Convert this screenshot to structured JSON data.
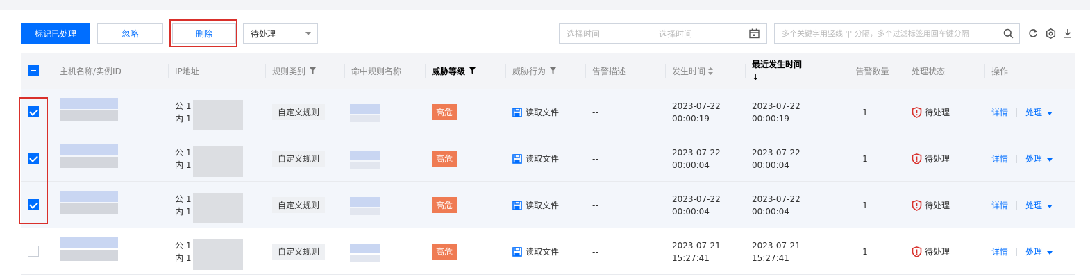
{
  "toolbar": {
    "mark_processed_label": "标记已处理",
    "ignore_label": "忽略",
    "delete_label": "删除",
    "status_filter_value": "待处理",
    "date_start_placeholder": "选择时间",
    "date_end_placeholder": "选择时间",
    "search_placeholder": "多个关键字用竖线 '|' 分隔，多个过滤标签用回车键分隔"
  },
  "colors": {
    "primary": "#006eff",
    "danger": "#d9302b",
    "high_risk": "#ef7b53"
  },
  "icons": [
    "calendar-icon",
    "search-icon",
    "refresh-icon",
    "settings-icon",
    "download-icon",
    "filter-icon",
    "sort-icon",
    "file-save-icon",
    "shield-alert-icon",
    "caret-down-icon"
  ],
  "columns": {
    "host": "主机名称/实例ID",
    "ip": "IP地址",
    "rule_type": "规则类别",
    "rule_name": "命中规则名称",
    "threat_level": "威胁等级",
    "threat_action": "威胁行为",
    "alert_desc": "告警描述",
    "occur_time": "发生时间",
    "latest_time_line1": "最近发生时间",
    "latest_time_line2": "↓",
    "alert_count": "告警数量",
    "status": "处理状态",
    "ops": "操作"
  },
  "rows": [
    {
      "checked": true,
      "ip_public": "公 1",
      "ip_private": "内 1",
      "rule_type": "自定义规则",
      "threat_level": "高危",
      "action": "读取文件",
      "desc": "--",
      "occur_date": "2023-07-22",
      "occur_time": "00:00:19",
      "latest_date": "2023-07-22",
      "latest_time": "00:00:19",
      "count": "1",
      "status": "待处理",
      "detail": "详情",
      "process": "处理"
    },
    {
      "checked": true,
      "ip_public": "公 1",
      "ip_private": "内 1",
      "rule_type": "自定义规则",
      "threat_level": "高危",
      "action": "读取文件",
      "desc": "--",
      "occur_date": "2023-07-22",
      "occur_time": "00:00:04",
      "latest_date": "2023-07-22",
      "latest_time": "00:00:04",
      "count": "1",
      "status": "待处理",
      "detail": "详情",
      "process": "处理"
    },
    {
      "checked": true,
      "ip_public": "公 1",
      "ip_private": "内 1",
      "rule_type": "自定义规则",
      "threat_level": "高危",
      "action": "读取文件",
      "desc": "--",
      "occur_date": "2023-07-22",
      "occur_time": "00:00:04",
      "latest_date": "2023-07-22",
      "latest_time": "00:00:04",
      "count": "1",
      "status": "待处理",
      "detail": "详情",
      "process": "处理"
    },
    {
      "checked": false,
      "ip_public": "公 1",
      "ip_private": "内 1",
      "rule_type": "自定义规则",
      "threat_level": "高危",
      "action": "读取文件",
      "desc": "--",
      "occur_date": "2023-07-21",
      "occur_time": "15:27:41",
      "latest_date": "2023-07-21",
      "latest_time": "15:27:41",
      "count": "1",
      "status": "待处理",
      "detail": "详情",
      "process": "处理"
    }
  ]
}
